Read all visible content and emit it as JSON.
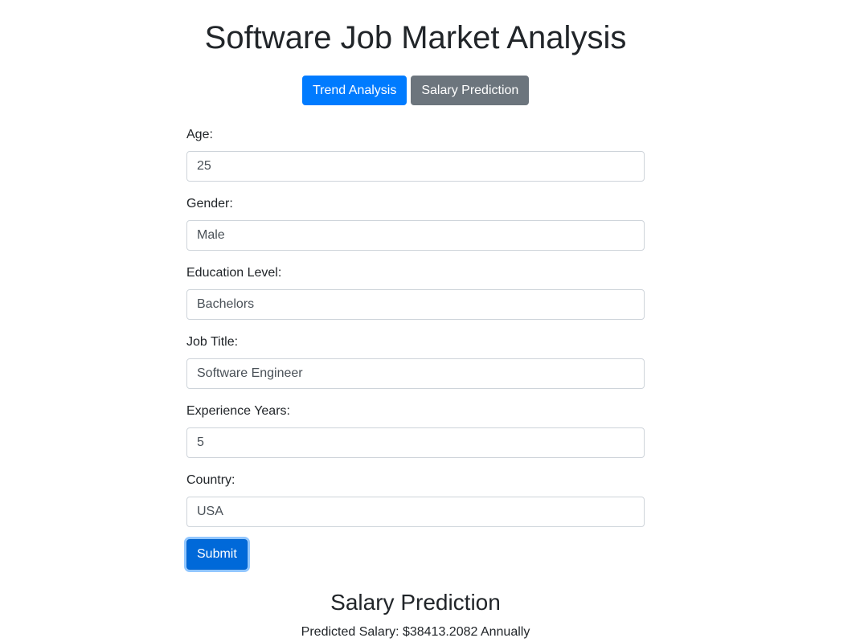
{
  "header": {
    "title": "Software Job Market Analysis"
  },
  "nav": {
    "trend_label": "Trend Analysis",
    "salary_label": "Salary Prediction"
  },
  "form": {
    "age": {
      "label": "Age:",
      "value": "25"
    },
    "gender": {
      "label": "Gender:",
      "value": "Male"
    },
    "education": {
      "label": "Education Level:",
      "value": "Bachelors"
    },
    "job_title": {
      "label": "Job Title:",
      "value": "Software Engineer"
    },
    "experience": {
      "label": "Experience Years:",
      "value": "5"
    },
    "country": {
      "label": "Country:",
      "value": "USA"
    },
    "submit_label": "Submit"
  },
  "result": {
    "title": "Salary Prediction",
    "text": "Predicted Salary: $38413.2082 Annually"
  },
  "colors": {
    "primary": "#007bff",
    "secondary": "#6c757d",
    "submit_active": "#0069d9"
  }
}
